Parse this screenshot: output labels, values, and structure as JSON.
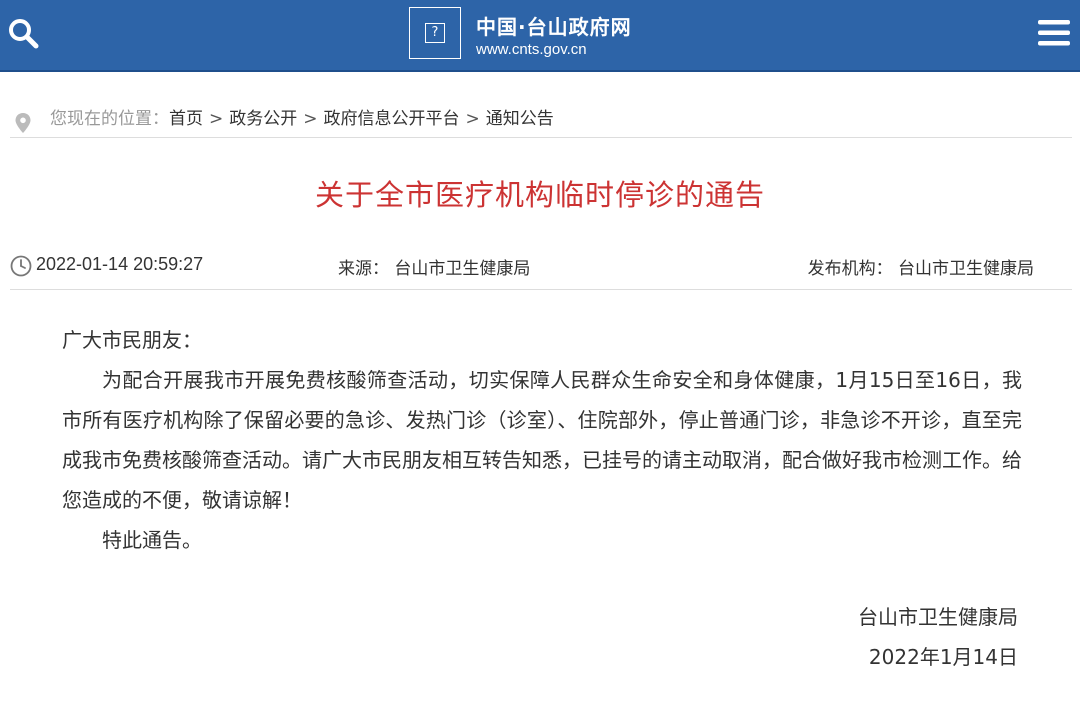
{
  "header": {
    "site_name": "中国·台山政府网",
    "site_url": "www.cnts.gov.cn",
    "logo_glyph": "?",
    "bg_color": "#2d64a8",
    "search_icon": "search-icon",
    "menu_icon": "menu-icon"
  },
  "breadcrumb": {
    "label": "您现在的位置：",
    "items": [
      "首页",
      "政务公开",
      "政府信息公开平台",
      "通知公告"
    ],
    "separator": ">"
  },
  "article": {
    "title": "关于全市医疗机构临时停诊的通告",
    "title_color": "#cc3333",
    "date": "2022-01-14 20:59:27",
    "source_label": "来源：",
    "source": "台山市卫生健康局",
    "publisher_label": "发布机构：",
    "publisher": "台山市卫生健康局",
    "greeting": "广大市民朋友：",
    "paragraph": "为配合开展我市开展免费核酸筛查活动，切实保障人民群众生命安全和身体健康，1月15日至16日，我市所有医疗机构除了保留必要的急诊、发热门诊（诊室）、住院部外，停止普通门诊，非急诊不开诊，直至完成我市免费核酸筛查活动。请广大市民朋友相互转告知悉，已挂号的请主动取消，配合做好我市检测工作。给您造成的不便，敬请谅解！",
    "closing": "特此通告。",
    "signature_org": "台山市卫生健康局",
    "signature_date": "2022年1月14日"
  }
}
